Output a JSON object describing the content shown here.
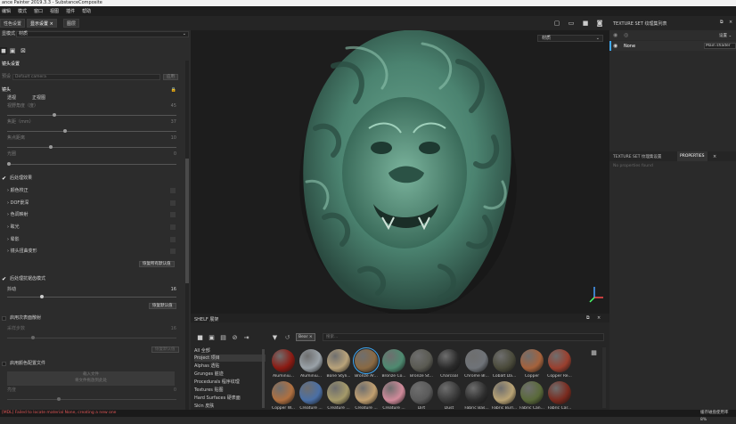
{
  "window": {
    "title": "ance Painter 2019.3.3 - SubstanceComposite"
  },
  "menu": [
    "编辑",
    "模式",
    "窗口",
    "视图",
    "插件",
    "帮助"
  ],
  "tabs": {
    "tab1": "性色设置",
    "tab2": "显示设置",
    "tab3": "图层"
  },
  "left": {
    "mode_label": "显模式",
    "mode_value": "材质",
    "section_camera_settings": "镜头设置",
    "preset_label": "预设",
    "preset_value": "Default camera",
    "preset_button": "应用",
    "section_camera": "镜头",
    "col1": "透视",
    "col2": "正视图",
    "sliders": [
      {
        "label": "视野角度（度）",
        "value": "45",
        "fill": 0.28
      },
      {
        "label": "焦距（mm）",
        "value": "37",
        "fill": 0.34
      },
      {
        "label": "焦点距离",
        "value": "10",
        "fill": 0.26
      },
      {
        "label": "光圈",
        "value": "0",
        "fill": 0.02
      }
    ],
    "postfx_label": "后处理效果",
    "postfx_items": [
      "颜色校正",
      "DOF景深",
      "色调映射",
      "眩光",
      "晕影",
      "镜头扭曲变形"
    ],
    "reset_button": "恢复所有默认值",
    "antialias_label": "后处理抗锯齿模式",
    "antialias_sub": "抖动",
    "antialias_value": "16",
    "antialias_fill": 0.25,
    "reset_button2": "恢复默认值",
    "subsurface_label": "启用次表面散射",
    "subsurface_sub": "采样步数",
    "subsurface_value": "16",
    "subsurface_fill": 0.2,
    "color_profile_label": "启用颜色配置文件",
    "load_button": "载入文件",
    "load_hint": "将文件拖放到此处",
    "bottom_label": "亮度",
    "bottom_value": "0",
    "bottom_fill": 0.3
  },
  "viewport": {
    "mode_dropdown": "材质"
  },
  "right": {
    "texture_set_list_label": "TEXTURE SET 纹理集列表",
    "settings_label": "设置",
    "item_name": "None",
    "item_shader": "Main shader",
    "tab_settings": "TEXTURE SET 纹理集设置",
    "tab_properties": "PROPERTIES",
    "no_properties": "No properties found"
  },
  "shelf": {
    "title": "SHELF 展架",
    "filter_tag": "Bear",
    "search_placeholder": "搜索...",
    "categories": [
      "All 全部",
      "Project 项目",
      "Alphas 透贴",
      "Grunges 脏迹",
      "Procedurals 程序纹理",
      "Textures 贴图",
      "Hard Surfaces 硬表面",
      "Skin 皮肤"
    ],
    "materials_row1": [
      {
        "name": "Aluminiu...",
        "color": "#8b1a12"
      },
      {
        "name": "Aluminiu...",
        "color": "#9aa2a8"
      },
      {
        "name": "Bone Styli...",
        "color": "#b9a37a"
      },
      {
        "name": "Bronze Ar...",
        "color": "#8a6a44"
      },
      {
        "name": "Bronze Co...",
        "color": "#4e8a70"
      },
      {
        "name": "Bronze St...",
        "color": "#5a5a52"
      },
      {
        "name": "Charcoal",
        "color": "#2a2a2a"
      },
      {
        "name": "Chrome Bl...",
        "color": "#6f7378"
      },
      {
        "name": "Cobalt Da...",
        "color": "#4a4a3a"
      },
      {
        "name": "Copper",
        "color": "#a5623c"
      },
      {
        "name": "Copper Re...",
        "color": "#9a3f2e"
      }
    ],
    "materials_row2": [
      {
        "name": "Copper W...",
        "color": "#b07040"
      },
      {
        "name": "Creature ...",
        "color": "#4a6fa5"
      },
      {
        "name": "Creature ...",
        "color": "#a59a6a"
      },
      {
        "name": "Creature ...",
        "color": "#c2a070"
      },
      {
        "name": "Creature ...",
        "color": "#d08a9a"
      },
      {
        "name": "Dirt",
        "color": "#5a5a5a"
      },
      {
        "name": "Dust",
        "color": "#3a3a3a"
      },
      {
        "name": "Fabric Bas...",
        "color": "#2e2e2e"
      },
      {
        "name": "Fabric Burl...",
        "color": "#b9a374"
      },
      {
        "name": "Fabric Can...",
        "color": "#5a6a3a"
      },
      {
        "name": "Fabric Car...",
        "color": "#7a2a1e"
      }
    ]
  },
  "status": {
    "error": "[MDL] Failed to locate material None, creating a new one",
    "right": "缓存磁盘使用率 8%"
  }
}
